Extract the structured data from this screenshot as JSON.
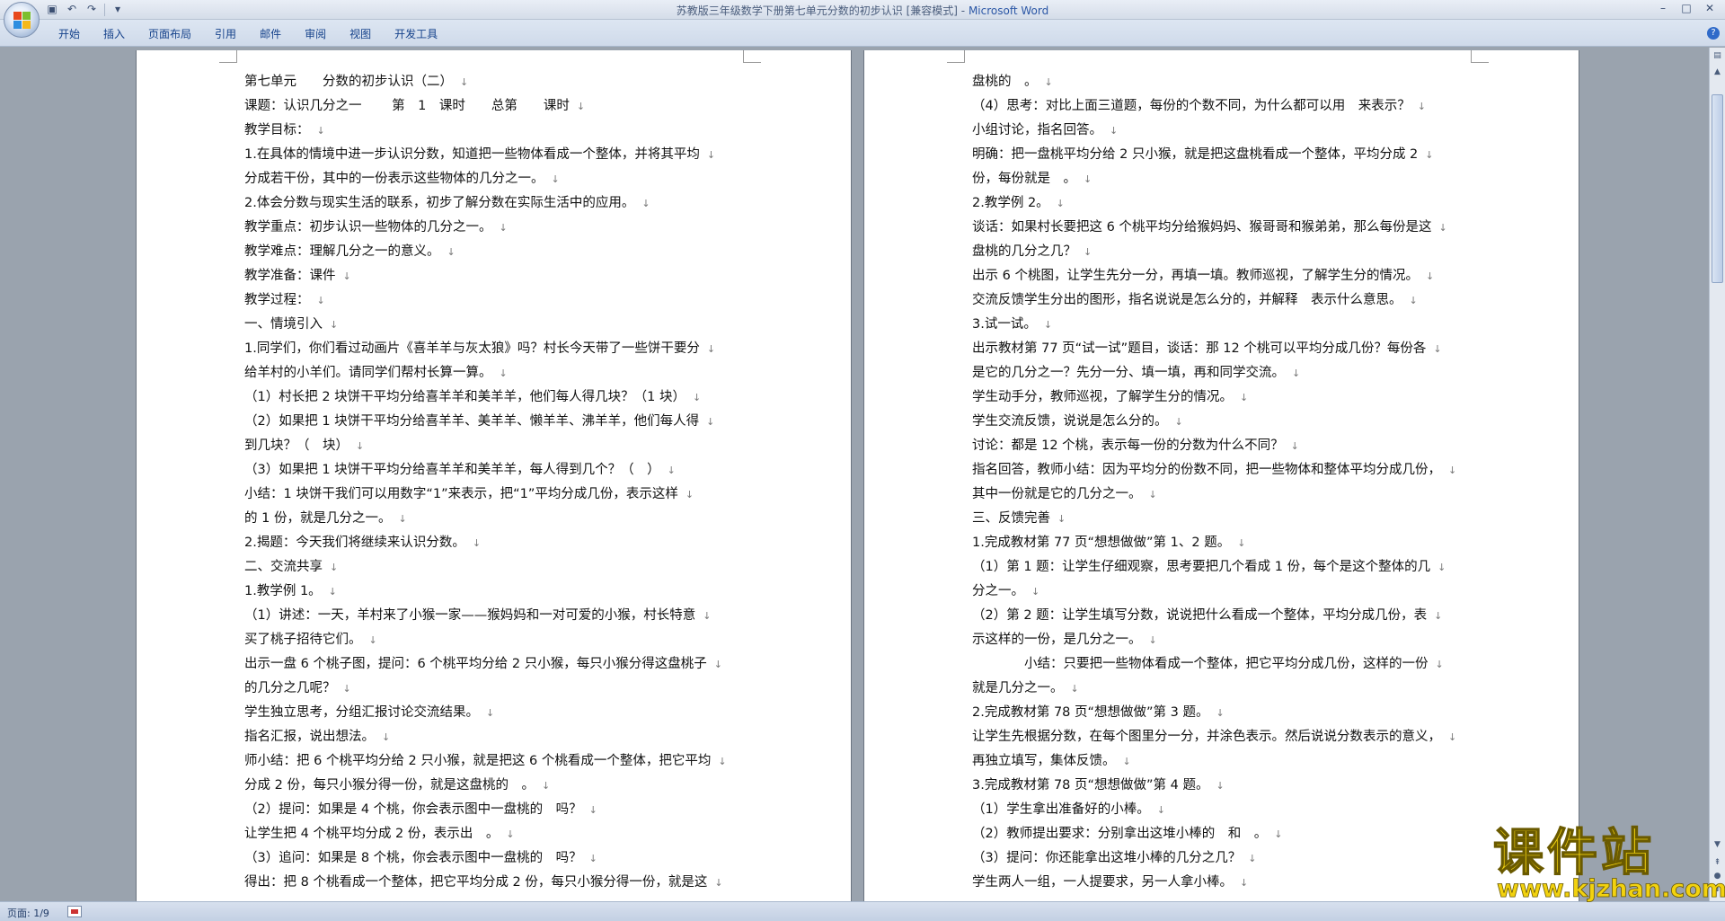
{
  "window": {
    "title": "苏教版三年级数学下册第七单元分数的初步认识 [兼容模式]",
    "title_sep": " - ",
    "app_name": "Microsoft Word",
    "controls": [
      "–",
      "□",
      "✕"
    ]
  },
  "quick_access": [
    "save-icon",
    "undo-icon",
    "redo-icon",
    "customize-icon"
  ],
  "ribbon": {
    "tabs": [
      "开始",
      "插入",
      "页面布局",
      "引用",
      "邮件",
      "审阅",
      "视图",
      "开发工具"
    ],
    "help": "?"
  },
  "paragraph_mark": "↓",
  "left_page": [
    "第七单元　　分数的初步认识（二）",
    "课题：认识几分之一　　 第　1　课时　　总第　　课时",
    "教学目标：",
    "1.在具体的情境中进一步认识分数，知道把一些物体看成一个整体，并将其平均",
    "分成若干份，其中的一份表示这些物体的几分之一。",
    "2.体会分数与现实生活的联系，初步了解分数在实际生活中的应用。",
    "教学重点：初步认识一些物体的几分之一。",
    "教学难点：理解几分之一的意义。",
    "教学准备：课件",
    "教学过程：",
    "一、情境引入",
    "1.同学们，你们看过动画片《喜羊羊与灰太狼》吗？村长今天带了一些饼干要分",
    "给羊村的小羊们。请同学们帮村长算一算。",
    "（1）村长把 2 块饼干平均分给喜羊羊和美羊羊，他们每人得几块？（1 块）",
    "（2）如果把 1 块饼干平均分给喜羊羊、美羊羊、懒羊羊、沸羊羊，他们每人得",
    "到几块？（　块）",
    "（3）如果把 1 块饼干平均分给喜羊羊和美羊羊，每人得到几个？（　）",
    "小结：1 块饼干我们可以用数字“1”来表示，把“1”平均分成几份，表示这样",
    "的 1 份，就是几分之一。",
    "2.揭题：今天我们将继续来认识分数。",
    "二、交流共享",
    "1.教学例 1。",
    "（1）讲述：一天，羊村来了小猴一家——猴妈妈和一对可爱的小猴，村长特意",
    "买了桃子招待它们。",
    "出示一盘 6 个桃子图，提问：6 个桃平均分给 2 只小猴，每只小猴分得这盘桃子",
    "的几分之几呢？",
    "学生独立思考，分组汇报讨论交流结果。",
    "指名汇报，说出想法。",
    "师小结：把 6 个桃平均分给 2 只小猴，就是把这 6 个桃看成一个整体，把它平均",
    "分成 2 份，每只小猴分得一份，就是这盘桃的　。",
    "（2）提问：如果是 4 个桃，你会表示图中一盘桃的　吗？",
    "让学生把 4 个桃平均分成 2 份，表示出　。",
    "（3）追问：如果是 8 个桃，你会表示图中一盘桃的　吗？",
    "得出：把 8 个桃看成一个整体，把它平均分成 2 份，每只小猴分得一份，就是这"
  ],
  "right_page": [
    "盘桃的　。",
    "（4）思考：对比上面三道题，每份的个数不同，为什么都可以用　来表示？",
    "小组讨论，指名回答。",
    "明确：把一盘桃平均分给 2 只小猴，就是把这盘桃看成一个整体，平均分成 2",
    "份，每份就是　。",
    "2.教学例 2。",
    "谈话：如果村长要把这 6 个桃平均分给猴妈妈、猴哥哥和猴弟弟，那么每份是这",
    "盘桃的几分之几？",
    "出示 6 个桃图，让学生先分一分，再填一填。教师巡视，了解学生分的情况。",
    "交流反馈学生分出的图形，指名说说是怎么分的，并解释　表示什么意思。",
    "3.试一试。",
    "出示教材第 77 页“试一试”题目，谈话：那 12 个桃可以平均分成几份？每份各",
    "是它的几分之一？先分一分、填一填，再和同学交流。",
    "学生动手分，教师巡视，了解学生分的情况。",
    "学生交流反馈，说说是怎么分的。",
    "讨论：都是 12 个桃，表示每一份的分数为什么不同？",
    "指名回答，教师小结：因为平均分的份数不同，把一些物体和整体平均分成几份，",
    "其中一份就是它的几分之一。",
    "三、反馈完善",
    "1.完成教材第 77 页“想想做做”第 1、2 题。",
    "（1）第 1 题：让学生仔细观察，思考要把几个看成 1 份，每个是这个整体的几",
    "分之一。",
    "（2）第 2 题：让学生填写分数，说说把什么看成一个整体，平均分成几份，表",
    "示这样的一份，是几分之一。",
    "　　　　小结：只要把一些物体看成一个整体，把它平均分成几份，这样的一份",
    "就是几分之一。",
    "2.完成教材第 78 页“想想做做”第 3 题。",
    "让学生先根据分数，在每个图里分一分，并涂色表示。然后说说分数表示的意义，",
    "再独立填写，集体反馈。",
    "3.完成教材第 78 页“想想做做”第 4 题。",
    "（1）学生拿出准备好的小棒。",
    "（2）教师提出要求：分别拿出这堆小棒的　和　。",
    "（3）提问：你还能拿出这堆小棒的几分之几？",
    "学生两人一组，一人提要求，另一人拿小棒。"
  ],
  "status": {
    "page": "页面: 1/9"
  },
  "watermark": {
    "title": "课件站",
    "url": "www.kjzhan.com"
  },
  "colors": {
    "accent": "#2b57a6",
    "watermark": "#f2d20f"
  }
}
